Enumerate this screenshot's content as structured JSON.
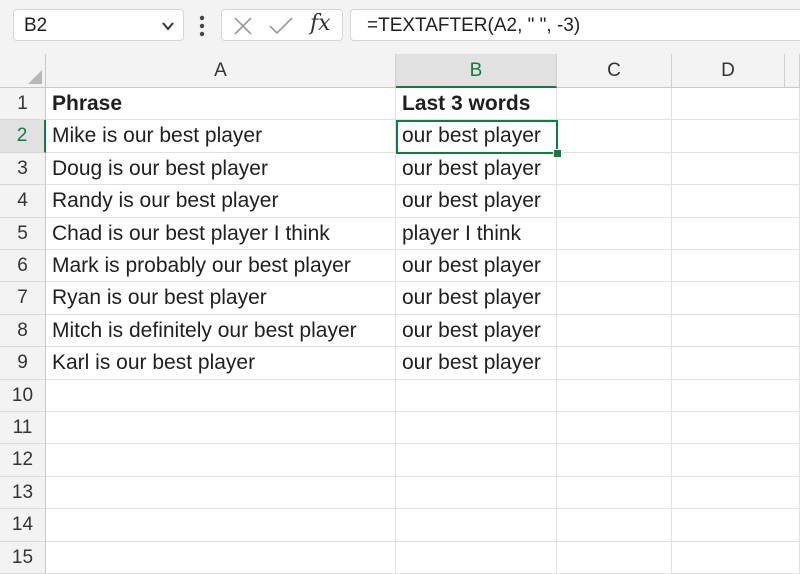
{
  "name_box": {
    "value": "B2"
  },
  "formula_bar": {
    "formula": "=TEXTAFTER(A2, \" \", -3)",
    "fx_label": "fx"
  },
  "icons": {
    "name_box_dropdown": "chevron-down-icon",
    "more": "vertical-ellipsis-icon",
    "cancel": "close-icon",
    "enter": "check-icon",
    "insert_function": "fx-icon"
  },
  "columns": [
    "A",
    "B",
    "C",
    "D"
  ],
  "selected_column": "B",
  "rows": [
    "1",
    "2",
    "3",
    "4",
    "5",
    "6",
    "7",
    "8",
    "9",
    "10",
    "11",
    "12",
    "13",
    "14",
    "15"
  ],
  "selected_row": "2",
  "cells": [
    {
      "A": "Phrase",
      "B": "Last 3 words",
      "header": true
    },
    {
      "A": "Mike is our best player",
      "B": "our best player"
    },
    {
      "A": "Doug is our best player",
      "B": "our best player"
    },
    {
      "A": "Randy is our best player",
      "B": "our best player"
    },
    {
      "A": "Chad is our best player I think",
      "B": "player I think"
    },
    {
      "A": "Mark is probably our best player",
      "B": "our best player"
    },
    {
      "A": "Ryan is our best player",
      "B": "our best player"
    },
    {
      "A": "Mitch is definitely our best player",
      "B": "our best player"
    },
    {
      "A": "Karl is our best player",
      "B": "our best player"
    }
  ],
  "colors": {
    "accent": "#107c41",
    "header_bg": "#f3f3f3",
    "selected_header_bg": "#e1e1e1"
  }
}
